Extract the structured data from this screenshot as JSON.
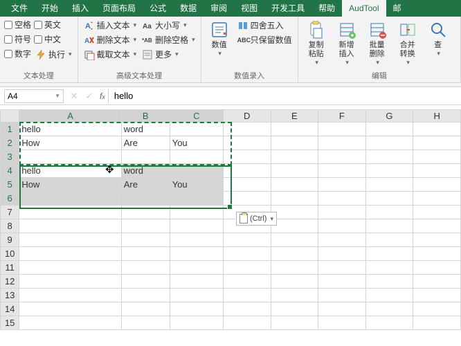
{
  "menu": {
    "items": [
      "文件",
      "开始",
      "插入",
      "页面布局",
      "公式",
      "数据",
      "审阅",
      "视图",
      "开发工具",
      "帮助",
      "AudTool",
      "邮"
    ],
    "activeIndex": 10
  },
  "ribbon": {
    "group1": {
      "label": "文本处理",
      "col1": [
        "空格",
        "符号",
        "数字"
      ],
      "col2_a": "英文",
      "col2_b": "中文",
      "col2_c": "执行"
    },
    "group2": {
      "label": "高级文本处理",
      "btns": [
        "插入文本",
        "删除文本",
        "截取文本"
      ],
      "btns2": [
        "大小写",
        "删除空格",
        "更多"
      ]
    },
    "group3": {
      "label": "数值录入",
      "numval": "数值",
      "round": "四舍五入",
      "keep": "只保留数值"
    },
    "group4": {
      "label": "编辑",
      "btns": [
        "复制粘贴",
        "新增插入",
        "批量删除",
        "合并转换",
        "查"
      ]
    }
  },
  "formulaBar": {
    "nameBox": "A4",
    "value": "hello"
  },
  "columns": [
    "A",
    "B",
    "C",
    "D",
    "E",
    "F",
    "G",
    "H"
  ],
  "rowCount": 15,
  "cells": {
    "A1": "hello",
    "B1": "word",
    "A2": "How",
    "B2": "Are",
    "C2": "You",
    "A4": "hello",
    "B4": "word",
    "A5": "How",
    "B5": "Are",
    "C5": "You"
  },
  "pasteOptions": {
    "label": "(Ctrl)"
  }
}
